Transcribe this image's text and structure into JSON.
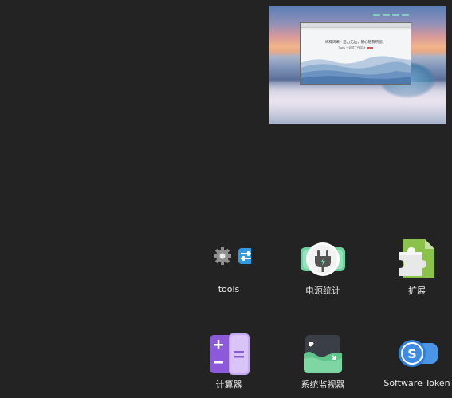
{
  "workspace_preview": {
    "window_headline": "纯粹风采 · 活力无边，随心随我所想。",
    "window_subtext": "Tools 一站式工作平台"
  },
  "apps": [
    {
      "id": "tools",
      "label": "tools",
      "icon": "tools-folder-icon"
    },
    {
      "id": "power-stats",
      "label": "电源统计",
      "icon": "power-plug-icon"
    },
    {
      "id": "extensions",
      "label": "扩展",
      "icon": "puzzle-icon"
    },
    {
      "id": "calculator",
      "label": "计算器",
      "icon": "calculator-icon"
    },
    {
      "id": "system-monitor",
      "label": "系统监视器",
      "icon": "monitor-icon"
    },
    {
      "id": "software-token",
      "label": "Software Token",
      "icon": "token-icon"
    }
  ],
  "colors": {
    "background": "#232323",
    "calculator_purple": "#8c5ad8",
    "power_green": "#6fd3a0",
    "puzzle_green": "#8bc34a",
    "token_blue": "#2f7fd8",
    "monitor_green": "#5fc58a"
  }
}
